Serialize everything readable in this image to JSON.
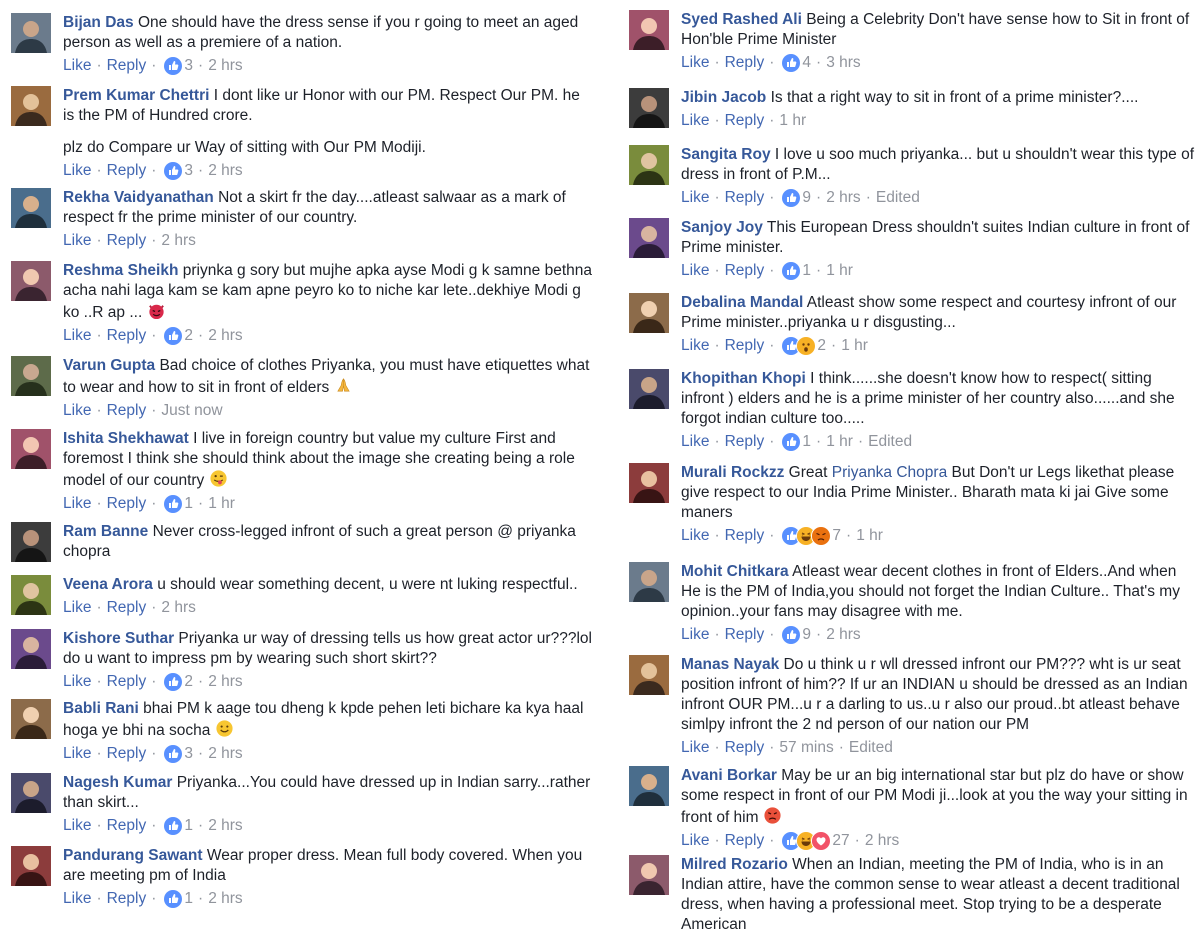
{
  "labels": {
    "like": "Like",
    "reply": "Reply"
  },
  "left": [
    {
      "author": "Bijan Das",
      "text": [
        "One should have the dress sense if you r going to meet an aged person as well as a premiere of a nation."
      ],
      "reactions": [
        "like"
      ],
      "count": "3",
      "time": "2 hrs",
      "edited": ""
    },
    {
      "author": "Prem Kumar Chettri",
      "text": [
        "I dont like ur Honor with our PM. Respect Our PM. he is the PM of Hundred crore.",
        "plz do Compare ur Way of sitting with Our PM Modiji."
      ],
      "reactions": [
        "like"
      ],
      "count": "3",
      "time": "2 hrs",
      "edited": ""
    },
    {
      "author": "Rekha Vaidyanathan",
      "text": [
        "Not a skirt fr the day....atleast salwaar as a mark of respect fr the prime minister of our country."
      ],
      "reactions": [],
      "count": "",
      "time": "2 hrs",
      "edited": ""
    },
    {
      "author": "Reshma Sheikh",
      "text": [
        "priynka g sory but mujhe apka ayse Modi g k samne bethna acha nahi laga kam se kam apne peyro ko to niche kar lete..dekhiye Modi g ko ..R ap ..."
      ],
      "emoji": "devil-emoji",
      "reactions": [
        "like"
      ],
      "count": "2",
      "time": "2 hrs",
      "edited": ""
    },
    {
      "author": "Varun Gupta",
      "text": [
        "Bad choice of clothes Priyanka, you must have etiquettes what to wear and how to sit in front of elders"
      ],
      "emoji": "pray-emoji",
      "reactions": [],
      "count": "",
      "time": "Just now",
      "edited": ""
    },
    {
      "author": "Ishita Shekhawat",
      "text": [
        "I live in foreign country but value my culture First and foremost I think she should think about the image she creating being a role model of our country"
      ],
      "emoji": "wink-tongue-emoji",
      "reactions": [
        "like"
      ],
      "count": "1",
      "time": "1 hr",
      "edited": ""
    },
    {
      "author": "Ram Banne",
      "text": [
        "Never cross-legged infront of such a great person @ priyanka chopra"
      ],
      "noActions": true
    },
    {
      "author": "Veena Arora",
      "text": [
        "u should wear something decent, u were nt luking respectful.."
      ],
      "reactions": [],
      "count": "",
      "time": "2 hrs",
      "edited": ""
    },
    {
      "author": "Kishore Suthar",
      "text": [
        "Priyanka ur way of dressing tells us how great actor ur???lol do u want to impress pm by wearing such short skirt??"
      ],
      "reactions": [
        "like"
      ],
      "count": "2",
      "time": "2 hrs",
      "edited": ""
    },
    {
      "author": "Babli Rani",
      "text": [
        "bhai PM k aage tou dheng k kpde pehen leti bichare ka kya haal hoga ye bhi na socha"
      ],
      "emoji": "smile-emoji",
      "reactions": [
        "like"
      ],
      "count": "3",
      "time": "2 hrs",
      "edited": ""
    },
    {
      "author": "Nagesh Kumar",
      "text": [
        "Priyanka...You could have dressed up in Indian sarry...rather than skirt..."
      ],
      "reactions": [
        "like"
      ],
      "count": "1",
      "time": "2 hrs",
      "edited": ""
    },
    {
      "author": "Pandurang Sawant",
      "text": [
        "Wear proper dress. Mean full body covered. When you are meeting pm of India"
      ],
      "reactions": [
        "like"
      ],
      "count": "1",
      "time": "2 hrs",
      "edited": ""
    }
  ],
  "right": [
    {
      "author": "Syed Rashed Ali",
      "text": [
        "Being a Celebrity Don't have sense how to Sit in front of Hon'ble Prime Minister"
      ],
      "reactions": [
        "like"
      ],
      "count": "4",
      "time": "3 hrs",
      "edited": ""
    },
    {
      "author": "Jibin Jacob",
      "text": [
        "Is that a right way to sit in front of a prime minister?...."
      ],
      "reactions": [],
      "count": "",
      "time": "1 hr",
      "edited": ""
    },
    {
      "author": "Sangita Roy",
      "text": [
        "I love u soo much priyanka... but u shouldn't wear this type of dress in front of P.M..."
      ],
      "reactions": [
        "like"
      ],
      "count": "9",
      "time": "2 hrs",
      "edited": "Edited"
    },
    {
      "author": "Sanjoy Joy",
      "text": [
        "This European Dress shouldn't suites Indian culture in front of Prime minister."
      ],
      "reactions": [
        "like"
      ],
      "count": "1",
      "time": "1 hr",
      "edited": ""
    },
    {
      "author": "Debalina Mandal",
      "text": [
        "Atleast show some respect and courtesy infront of our Prime minister..priyanka u r disgusting..."
      ],
      "reactions": [
        "like",
        "wow"
      ],
      "count": "2",
      "time": "1 hr",
      "edited": ""
    },
    {
      "author": "Khopithan Khopi",
      "text": [
        "I think......she doesn't know how to respect( sitting infront ) elders and he is a prime minister of her country also......and she forgot indian culture too....."
      ],
      "reactions": [
        "like"
      ],
      "count": "1",
      "time": "1 hr",
      "edited": "Edited"
    },
    {
      "author": "Murali Rockzz",
      "text": [
        "Great",
        "Priyanka Chopra",
        "But Don't ur Legs likethat please give respect to our India Prime Minister.. Bharath mata ki jai Give some maners"
      ],
      "mention": true,
      "reactions": [
        "like",
        "haha",
        "angry"
      ],
      "count": "7",
      "time": "1 hr",
      "edited": ""
    },
    {
      "author": "Mohit Chitkara",
      "text": [
        "Atleast wear decent clothes in front of Elders..And when He is the PM of India,you should not forget the Indian Culture.. That's my opinion..your fans may disagree with me."
      ],
      "reactions": [
        "like"
      ],
      "count": "9",
      "time": "2 hrs",
      "edited": ""
    },
    {
      "author": "Manas Nayak",
      "text": [
        "Do u think u r wll dressed infront our PM??? wht is ur seat position infront of him?? If ur an INDIAN u should be dressed as an Indian infront OUR PM...u r a darling to us..u r also our proud..bt atleast behave simlpy infront the 2 nd person of our nation our PM"
      ],
      "reactions": [],
      "count": "",
      "time": "57 mins",
      "edited": "Edited"
    },
    {
      "author": "Avani Borkar",
      "text": [
        "May be ur an big international star but plz do have or show some respect in front of our PM Modi ji...look at you the way your sitting in front of him"
      ],
      "emoji": "angry-emoji",
      "reactions": [
        "like",
        "haha",
        "love"
      ],
      "count": "27",
      "time": "2 hrs",
      "edited": ""
    },
    {
      "author": "Milred Rozario",
      "text": [
        "When an Indian, meeting the PM of India, who is in an Indian attire, have the common sense to wear atleast a decent traditional dress, when having a professional meet. Stop trying to be a desperate American"
      ],
      "noActions": true
    }
  ],
  "colors": {
    "link": "#365899",
    "action": "#4267b2",
    "meta": "#90949c",
    "like": "#5890ff",
    "haha": "#f7b125",
    "angry": "#e9710f",
    "love": "#f25268"
  }
}
